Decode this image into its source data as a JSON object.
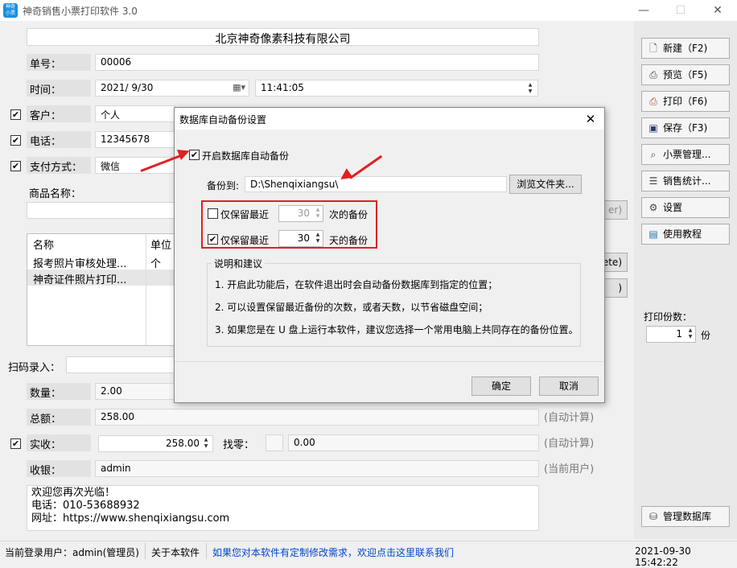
{
  "window": {
    "title": "神奇销售小票打印软件 3.0",
    "icon_text": "神奇 小票",
    "min_glyph": "—",
    "max_glyph": "☐",
    "close_glyph": "✕"
  },
  "form": {
    "company": "北京神奇像素科技有限公司",
    "order_no_label": "单号：",
    "order_no": "00006",
    "time_label": "时间：",
    "date_value": "2021/ 9/30",
    "time_value": "11:41:05",
    "customer_label": "客户：",
    "customer_value": "个人",
    "phone_label": "电话：",
    "phone_value": "12345678",
    "payment_label": "支付方式：",
    "payment_value": "微信",
    "product_label": "商品名称：",
    "grid_headers": [
      "名称",
      "单位"
    ],
    "grid_rows": [
      [
        "报考照片审核处理...",
        "个"
      ],
      [
        "神奇证件照片打印...",
        ""
      ]
    ],
    "partial_btn_1": "er)",
    "partial_btn_2": "ete)",
    "partial_btn_3": ")",
    "scan_label": "扫码录入：",
    "qty_label": "数量：",
    "qty_value": "2.00",
    "total_label": "总额：",
    "total_value": "258.00",
    "auto_calc_1": "(自动计算)",
    "received_label": "实收：",
    "received_value": "258.00",
    "change_label": "找零：",
    "change_value": "0.00",
    "auto_calc_2": "(自动计算)",
    "cashier_label": "收银：",
    "cashier_value": "admin",
    "current_user_hint": "(当前用户)",
    "footer_line1": "欢迎您再次光临！",
    "footer_line2": "电话：010-53688932",
    "footer_line3": "网址：https://www.shenqixiangsu.com"
  },
  "right_panel": {
    "new_btn": "新建（F2)",
    "preview_btn": "预览（F5)",
    "print_btn": "打印（F6)",
    "save_btn": "保存（F3)",
    "ticket_mgmt_btn": "小票管理...",
    "sales_stats_btn": "销售统计...",
    "settings_btn": "设置",
    "tutorial_btn": "使用教程",
    "copies_label": "打印份数：",
    "copies_value": "1",
    "copies_unit": "份",
    "db_mgmt_btn": "管理数据库"
  },
  "dialog": {
    "title": "数据库自动备份设置",
    "enable_label": "开启数据库自动备份",
    "enable_checked": true,
    "backup_to_label": "备份到:",
    "backup_path": "D:\\Shenqixiangsu\\",
    "browse_btn": "浏览文件夹...",
    "keep_count_label": "仅保留最近",
    "keep_count_value": "30",
    "keep_count_unit": "次的备份",
    "keep_days_label": "仅保留最近",
    "keep_days_value": "30",
    "keep_days_unit": "天的备份",
    "notes_title": "说明和建议",
    "note1": "1. 开启此功能后，在软件退出时会自动备份数据库到指定的位置；",
    "note2": "2. 可以设置保留最近备份的次数，或者天数，以节省磁盘空间；",
    "note3": "3. 如果您是在 U 盘上运行本软件，建议您选择一个常用电脑上共同存在的备份位置。",
    "ok_btn": "确定",
    "cancel_btn": "取消"
  },
  "status": {
    "login_user": "当前登录用户：admin(管理员)",
    "about": "关于本软件",
    "custom_link": "如果您对本软件有定制修改需求，欢迎点击这里联系我们",
    "datetime": "2021-09-30 15:42:22"
  },
  "colors": {
    "accent": "#1a8fe0",
    "highlight": "#e02020",
    "link": "#0044cc"
  }
}
